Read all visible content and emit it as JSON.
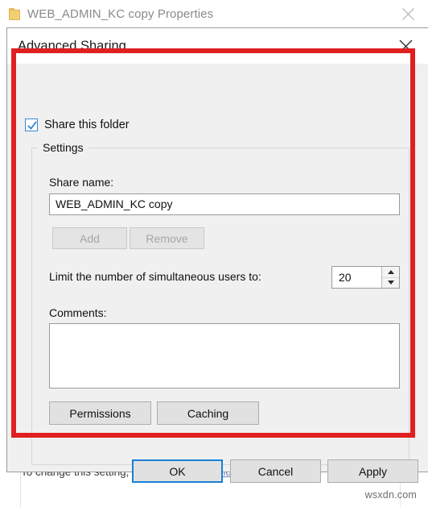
{
  "parent_window": {
    "title": "WEB_ADMIN_KC copy Properties",
    "folder_icon": "folder-icon",
    "close_icon": "close-icon",
    "footer_text_before": "To change this setting, use the ",
    "footer_link": "Network and Sharing Center",
    "footer_text_after": ".",
    "watermark": "wsxdn.com"
  },
  "dialog": {
    "title": "Advanced Sharing",
    "close_icon": "close-icon",
    "share_checkbox": {
      "label": "Share this folder",
      "checked": true,
      "check_icon": "checkmark-icon"
    },
    "settings_group": {
      "title": "Settings",
      "share_name_label": "Share name:",
      "share_name_value": "WEB_ADMIN_KC copy",
      "add_button": "Add",
      "remove_button": "Remove",
      "limit_label": "Limit the number of simultaneous users to:",
      "limit_value": "20",
      "spinner_up_icon": "chevron-up-icon",
      "spinner_down_icon": "chevron-down-icon",
      "comments_label": "Comments:",
      "comments_value": "",
      "permissions_button": "Permissions",
      "caching_button": "Caching"
    },
    "ok_button": "OK",
    "cancel_button": "Cancel",
    "apply_button": "Apply"
  },
  "colors": {
    "annotation_red": "#e02020",
    "accent_blue": "#1a7fd4",
    "dialog_bg": "#f0f0f0",
    "link_blue": "#6a86b8"
  }
}
